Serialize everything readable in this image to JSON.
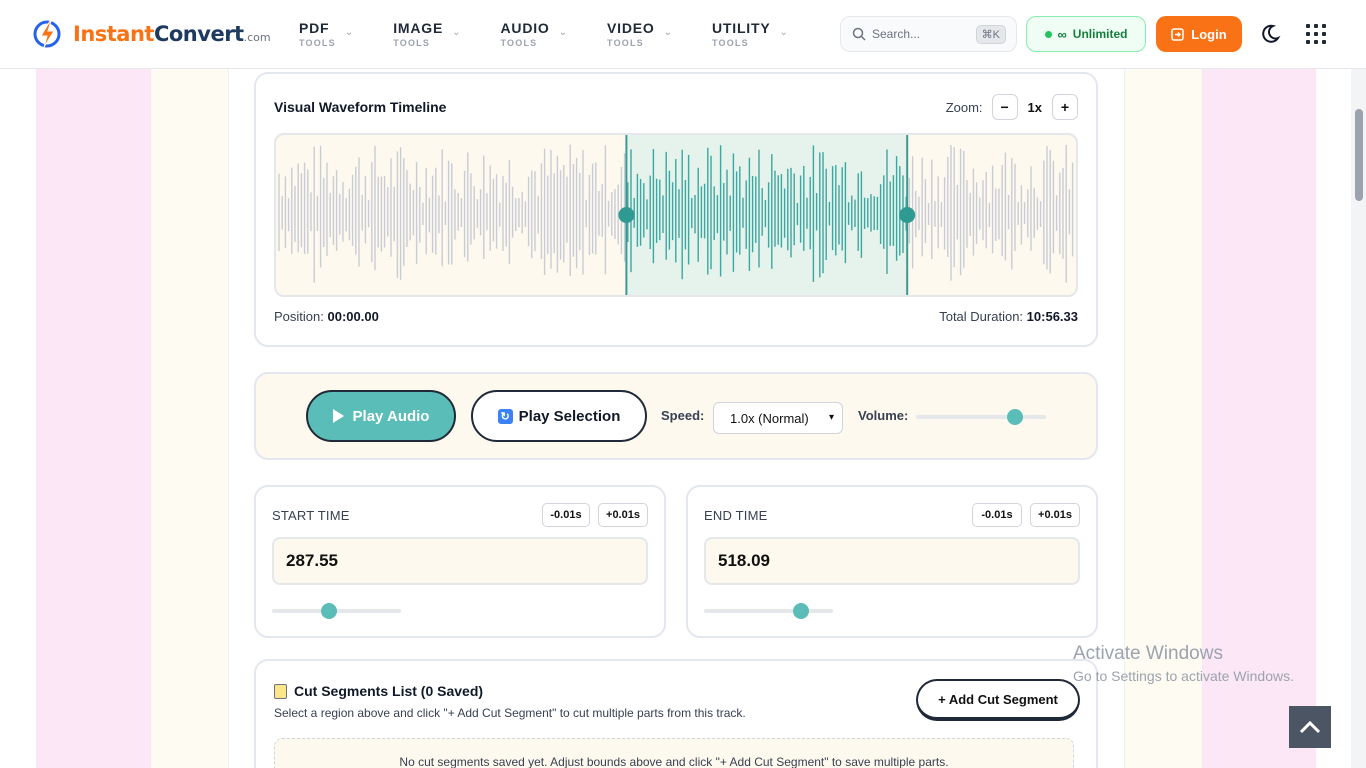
{
  "header": {
    "logo": {
      "part1": "Instant",
      "part2": "Convert",
      "domain": ".com"
    },
    "nav": [
      {
        "label": "PDF",
        "sub": "TOOLS"
      },
      {
        "label": "IMAGE",
        "sub": "TOOLS"
      },
      {
        "label": "AUDIO",
        "sub": "TOOLS"
      },
      {
        "label": "VIDEO",
        "sub": "TOOLS"
      },
      {
        "label": "UTILITY",
        "sub": "TOOLS"
      }
    ],
    "search": {
      "placeholder": "Search...",
      "shortcut": "⌘K"
    },
    "plan_badge": "Unlimited",
    "login_label": "Login",
    "colors": {
      "accent": "#f97316",
      "teal": "#5bbdb8",
      "green": "#15803d"
    }
  },
  "waveform": {
    "title": "Visual Waveform Timeline",
    "zoom_label": "Zoom:",
    "zoom_minus": "−",
    "zoom_value": "1x",
    "zoom_plus": "+",
    "position_label": "Position:",
    "position_value": "00:00.00",
    "duration_label": "Total Duration:",
    "duration_value": "10:56.33",
    "selection_start_fraction": 0.438,
    "selection_end_fraction": 0.789
  },
  "controls": {
    "play_label": "Play Audio",
    "play_selection_label": "Play Selection",
    "speed_label": "Speed:",
    "speed_value": "1.0x (Normal)",
    "volume_label": "Volume:",
    "volume_fraction": 0.76
  },
  "start_time": {
    "label": "START TIME",
    "minus": "-0.01s",
    "plus": "+0.01s",
    "value": "287.55",
    "slider_fraction": 0.44
  },
  "end_time": {
    "label": "END TIME",
    "minus": "-0.01s",
    "plus": "+0.01s",
    "value": "518.09",
    "slider_fraction": 0.75
  },
  "segments": {
    "title": "Cut Segments List (0 Saved)",
    "subtitle": "Select a region above and click \"+ Add Cut Segment\" to cut multiple parts from this track.",
    "add_label": "+ Add Cut Segment",
    "empty_text": "No cut segments saved yet. Adjust bounds above and click \"+ Add Cut Segment\" to save multiple parts."
  },
  "watermark": {
    "line1": "Activate Windows",
    "line2": "Go to Settings to activate Windows."
  }
}
